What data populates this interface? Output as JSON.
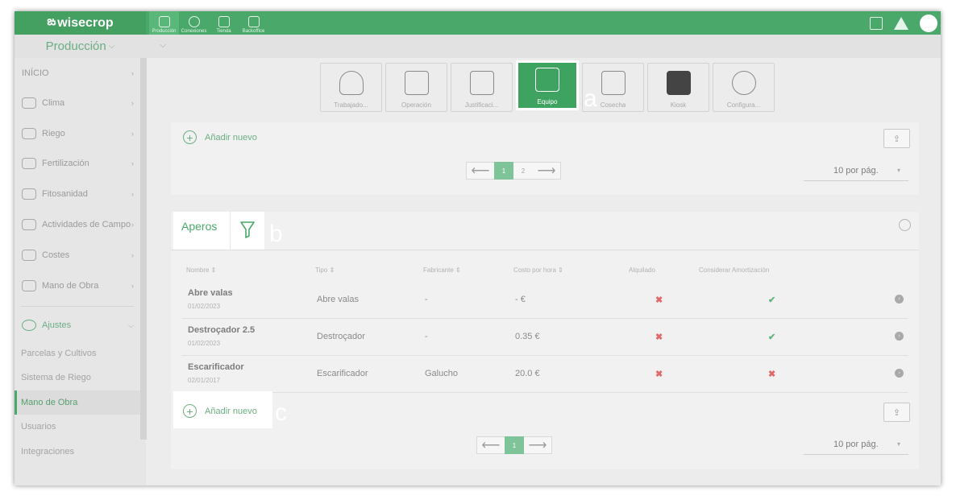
{
  "topbar": {
    "logo": "wisecrop",
    "nav": [
      {
        "label": "Producción",
        "icon": "farm-icon",
        "active": true
      },
      {
        "label": "Conexiones",
        "icon": "network-icon",
        "active": false
      },
      {
        "label": "Tienda",
        "icon": "store-icon",
        "active": false
      },
      {
        "label": "Backoffice",
        "icon": "admin-icon",
        "active": false
      }
    ]
  },
  "subbar": {
    "production_select": "Producción"
  },
  "sidebar": {
    "items": [
      {
        "label": "INÍCIO",
        "icon": ""
      },
      {
        "label": "Clima",
        "icon": "cloud-icon"
      },
      {
        "label": "Riego",
        "icon": "sprinkler-icon"
      },
      {
        "label": "Fertilización",
        "icon": "fertilizer-icon"
      },
      {
        "label": "Fitosanidad",
        "icon": "pest-icon"
      },
      {
        "label": "Actividades de Campo",
        "icon": "activities-icon"
      },
      {
        "label": "Costes",
        "icon": "coins-icon"
      },
      {
        "label": "Mano de Obra",
        "icon": "worker-icon"
      }
    ],
    "settings": "Ajustes",
    "sub_items": [
      {
        "label": "Parcelas y Cultivos",
        "active": false
      },
      {
        "label": "Sistema de Riego",
        "active": false
      },
      {
        "label": "Mano de Obra",
        "active": true
      },
      {
        "label": "Usuarios",
        "active": false
      },
      {
        "label": "Integraciones",
        "active": false
      }
    ]
  },
  "modules": [
    {
      "label": "Trabajado...",
      "icon": "worker-hat-icon"
    },
    {
      "label": "Operación",
      "icon": "list-icon"
    },
    {
      "label": "Justificaci...",
      "icon": "document-check-icon"
    },
    {
      "label": "Equipo",
      "icon": "tractor-icon",
      "active": true
    },
    {
      "label": "Cosecha",
      "icon": "harvest-icon"
    },
    {
      "label": "Kiosk",
      "icon": "qr-icon"
    },
    {
      "label": "Configura...",
      "icon": "tools-icon"
    }
  ],
  "annotations": {
    "a": "a",
    "b": "b",
    "c": "c"
  },
  "card1": {
    "add_label": "Añadir nuevo",
    "pages": [
      "1",
      "2"
    ],
    "per_page": "10 por pág."
  },
  "card2": {
    "title": "Aperos",
    "columns": [
      "Nombre ⇕",
      "Tipo ⇕",
      "Fabricante ⇕",
      "Costo por hora ⇕",
      "Alquilado",
      "Considerar Amortización"
    ],
    "rows": [
      {
        "name": "Abre valas",
        "date": "01/02/2023",
        "tipo": "Abre valas",
        "fabricante": "-",
        "costo": "- €",
        "alquilado": "✖",
        "amortizacion": "✔"
      },
      {
        "name": "Destroçador 2.5",
        "date": "01/02/2023",
        "tipo": "Destroçador",
        "fabricante": "-",
        "costo": "0.35 €",
        "alquilado": "✖",
        "amortizacion": "✔"
      },
      {
        "name": "Escarificador",
        "date": "02/01/2017",
        "tipo": "Escarificador",
        "fabricante": "Galucho",
        "costo": "20.0 €",
        "alquilado": "✖",
        "amortizacion": "✖"
      }
    ],
    "add_label": "Añadir nuevo",
    "pages": [
      "1"
    ],
    "per_page": "10 por pág."
  },
  "colors": {
    "brand_green": "#4aa96a",
    "error_red": "#e26a6a"
  }
}
